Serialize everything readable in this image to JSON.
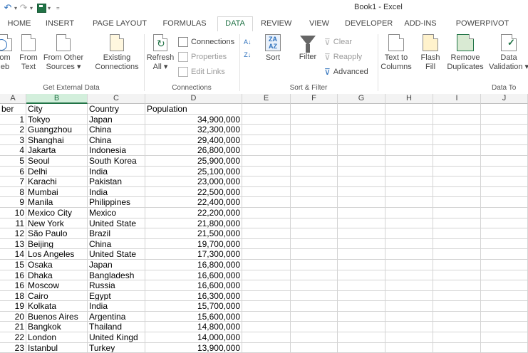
{
  "title": "Book1 - Excel",
  "qat": {
    "undo_icon": "undo-icon",
    "redo_icon": "redo-icon",
    "save_icon": "save-icon"
  },
  "tabs": [
    "HOME",
    "INSERT",
    "PAGE LAYOUT",
    "FORMULAS",
    "DATA",
    "REVIEW",
    "VIEW",
    "DEVELOPER",
    "ADD-INS",
    "POWERPIVOT"
  ],
  "active_tab": "DATA",
  "ribbon": {
    "get_external": {
      "group_label": "Get External Data",
      "from_web": [
        "om",
        "eb"
      ],
      "from_text": [
        "From",
        "Text"
      ],
      "from_other": [
        "From Other",
        "Sources ▾"
      ],
      "existing": [
        "Existing",
        "Connections"
      ]
    },
    "connections": {
      "group_label": "Connections",
      "refresh": [
        "Refresh",
        "All ▾"
      ],
      "connections": "Connections",
      "properties": "Properties",
      "edit_links": "Edit Links"
    },
    "sort_filter": {
      "group_label": "Sort & Filter",
      "sort": "Sort",
      "filter": "Filter",
      "clear": "Clear",
      "reapply": "Reapply",
      "advanced": "Advanced"
    },
    "data_tools": {
      "group_label": "Data To",
      "text_to_columns": [
        "Text to",
        "Columns"
      ],
      "flash_fill": [
        "Flash",
        "Fill"
      ],
      "remove_duplicates": [
        "Remove",
        "Duplicates"
      ],
      "data_validation": [
        "Data",
        "Validation ▾"
      ]
    }
  },
  "columns": [
    "A",
    "B",
    "C",
    "D",
    "E",
    "F",
    "G",
    "H",
    "I",
    "J"
  ],
  "selected_column": "B",
  "header_row": [
    "ber",
    "City",
    "Country",
    "Population"
  ],
  "rows": [
    [
      "1",
      "Tokyo",
      "Japan",
      "34,900,000"
    ],
    [
      "2",
      "Guangzhou",
      "China",
      "32,300,000"
    ],
    [
      "3",
      "Shanghai",
      "China",
      "29,400,000"
    ],
    [
      "4",
      "Jakarta",
      "Indonesia",
      "26,800,000"
    ],
    [
      "5",
      "Seoul",
      "South Korea",
      "25,900,000"
    ],
    [
      "6",
      "Delhi",
      "India",
      "25,100,000"
    ],
    [
      "7",
      "Karachi",
      "Pakistan",
      "23,000,000"
    ],
    [
      "8",
      "Mumbai",
      "India",
      "22,500,000"
    ],
    [
      "9",
      "Manila",
      "Philippines",
      "22,400,000"
    ],
    [
      "10",
      "Mexico City",
      "Mexico",
      "22,200,000"
    ],
    [
      "11",
      "New York",
      "United State",
      "21,800,000"
    ],
    [
      "12",
      "São Paulo",
      "Brazil",
      "21,500,000"
    ],
    [
      "13",
      "Beijing",
      "China",
      "19,700,000"
    ],
    [
      "14",
      "Los Angeles",
      "United State",
      "17,300,000"
    ],
    [
      "15",
      "Osaka",
      "Japan",
      "16,800,000"
    ],
    [
      "16",
      "Dhaka",
      "Bangladesh",
      "16,600,000"
    ],
    [
      "16",
      "Moscow",
      "Russia",
      "16,600,000"
    ],
    [
      "18",
      "Cairo",
      "Egypt",
      "16,300,000"
    ],
    [
      "19",
      "Kolkata",
      "India",
      "15,700,000"
    ],
    [
      "20",
      "Buenos Aires",
      "Argentina",
      "15,600,000"
    ],
    [
      "21",
      "Bangkok",
      "Thailand",
      "14,800,000"
    ],
    [
      "22",
      "London",
      "United Kingd",
      "14,000,000"
    ],
    [
      "23",
      "Istanbul",
      "Turkey",
      "13,900,000"
    ]
  ]
}
